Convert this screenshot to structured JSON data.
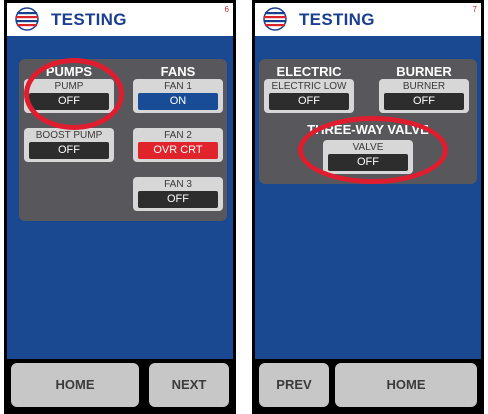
{
  "screens": [
    {
      "title": "TESTING",
      "page": "6",
      "columns": [
        "PUMPS",
        "FANS"
      ],
      "tiles": {
        "pump": {
          "label": "PUMP",
          "value": "OFF"
        },
        "boost_pump": {
          "label": "BOOST PUMP",
          "value": "OFF"
        },
        "fan1": {
          "label": "FAN 1",
          "value": "ON"
        },
        "fan2": {
          "label": "FAN 2",
          "value": "OVR CRT"
        },
        "fan3": {
          "label": "FAN 3",
          "value": "OFF"
        }
      },
      "footer": {
        "home": "HOME",
        "next": "NEXT"
      }
    },
    {
      "title": "TESTING",
      "page": "7",
      "columns": [
        "ELECTRIC",
        "BURNER"
      ],
      "section": "THREE-WAY VALVE",
      "tiles": {
        "electric_low": {
          "label": "ELECTRIC LOW",
          "value": "OFF"
        },
        "burner": {
          "label": "BURNER",
          "value": "OFF"
        },
        "valve": {
          "label": "VALVE",
          "value": "OFF"
        }
      },
      "footer": {
        "prev": "PREV",
        "home": "HOME"
      }
    }
  ],
  "colors": {
    "brand": "#1b3f8f",
    "background": "#1a4991",
    "panel": "#58585c",
    "on": "#184c97",
    "alarm": "#e1232b",
    "annotation_ring": "#e01d2e"
  },
  "icons": {
    "logo": "layered-globe-icon"
  }
}
